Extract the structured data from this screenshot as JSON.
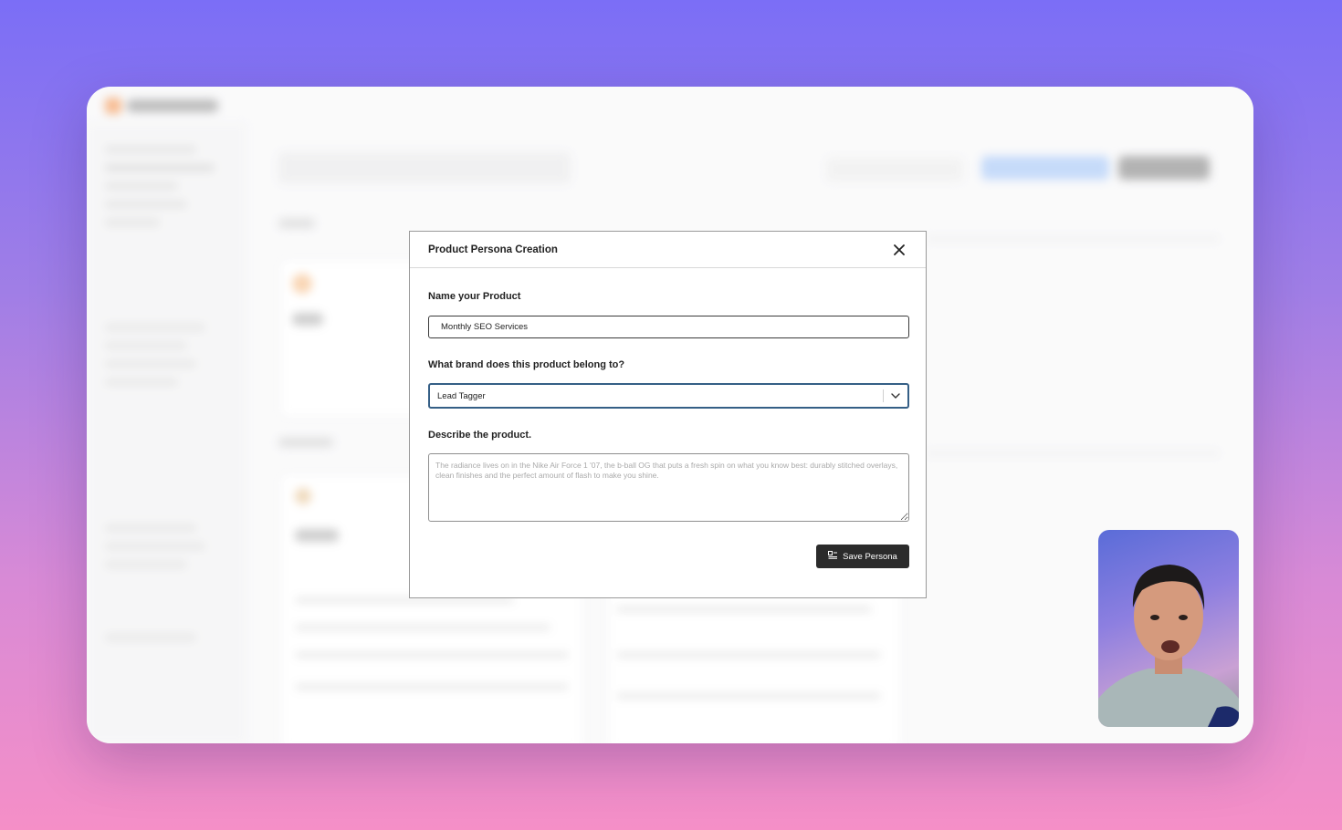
{
  "modal": {
    "title": "Product Persona Creation",
    "close_icon": "close-icon",
    "name_label": "Name your Product",
    "name_value": "Monthly SEO Services",
    "brand_label": "What brand does this product belong to?",
    "brand_value": "Lead Tagger",
    "describe_label": "Describe the product.",
    "describe_placeholder": "The radiance lives on in the Nike Air Force 1 '07, the b-ball OG that puts a fresh spin on what you know best: durably stitched overlays, clean finishes and the perfect amount of flash to make you shine.",
    "save_label": "Save Persona",
    "save_icon": "save-persona-icon"
  },
  "colors": {
    "background_top": "#7b6ef6",
    "background_bottom": "#f58fc7",
    "select_border": "#355f86",
    "save_button": "#2b2b2b"
  }
}
